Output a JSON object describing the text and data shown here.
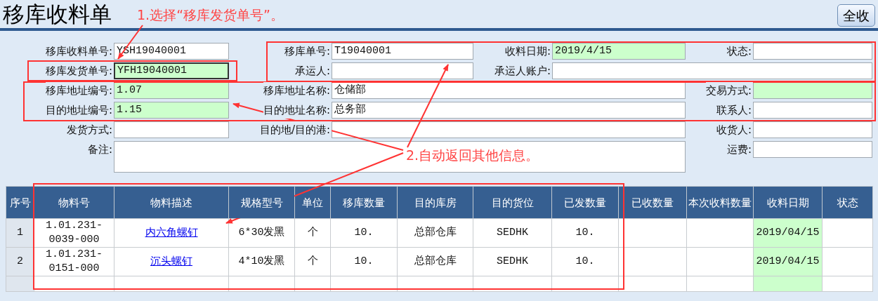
{
  "title": "移库收料单",
  "receive_all_button": "全收",
  "form": {
    "rows": [
      [
        {
          "label": "移库收料单号:",
          "value": "YSH19040001",
          "highlighted": false,
          "focused": false
        },
        {
          "label": "移库单号:",
          "value": "T19040001",
          "highlighted": false,
          "focused": false
        },
        {
          "label": "收料日期:",
          "value": "2019/4/15",
          "highlighted": true,
          "focused": false
        },
        {
          "label": "状态:",
          "highlighted": false,
          "focused": false
        }
      ],
      [
        {
          "label": "移库发货单号:",
          "value": "YFH19040001",
          "highlighted": true,
          "focused": true
        },
        {
          "label": "承运人:",
          "highlighted": false,
          "focused": false
        },
        {
          "label": "承运人账户:",
          "highlighted": false,
          "focused": false
        }
      ],
      [
        {
          "label": "移库地址编号:",
          "value": "1.07",
          "highlighted": true,
          "focused": false
        },
        {
          "label": "移库地址名称:",
          "value": "仓储部",
          "highlighted": false,
          "focused": false
        },
        {
          "label": "交易方式:",
          "highlighted": true,
          "focused": false
        }
      ],
      [
        {
          "label": "目的地址编号:",
          "value": "1.15",
          "highlighted": true,
          "focused": false
        },
        {
          "label": "目的地址名称:",
          "value": "总务部",
          "highlighted": false,
          "focused": false
        },
        {
          "label": "联系人:",
          "highlighted": false,
          "focused": false
        }
      ],
      [
        {
          "label": "发货方式:",
          "highlighted": false,
          "focused": false
        },
        {
          "label": "目的地/目的港:",
          "highlighted": false,
          "focused": false
        },
        {
          "label": "收货人:",
          "highlighted": false,
          "focused": false
        }
      ]
    ],
    "remark": {
      "label": "备注:",
      "highlighted": false,
      "focused": false
    },
    "freight": {
      "label": "运费:",
      "highlighted": false,
      "focused": false
    }
  },
  "table": {
    "columns": [
      "序号",
      "物料号",
      "物料描述",
      "规格型号",
      "单位",
      "移库数量",
      "目的库房",
      "目的货位",
      "已发数量",
      "已收数量",
      "本次收料数量",
      "收料日期",
      "状态"
    ],
    "rows": [
      {
        "no": "1",
        "material_no": "1.01.231-0039-000",
        "description": "内六角螺钉",
        "spec": "6*30发黑",
        "unit": "个",
        "transfer_qty": "10.",
        "warehouse": "总部仓库",
        "location": "SEDHK",
        "shipped_qty": "10.",
        "receive_date": "2019/04/15",
        "highlighted": true
      },
      {
        "no": "2",
        "material_no": "1.01.231-0151-000",
        "description": "沉头螺钉",
        "spec": "4*10发黑",
        "unit": "个",
        "transfer_qty": "10.",
        "warehouse": "总部仓库",
        "location": "SEDHK",
        "shipped_qty": "10.",
        "receive_date": "2019/04/15",
        "highlighted": true
      },
      {
        "highlighted": true
      }
    ]
  },
  "annotations": [
    {
      "text": "1.选择“移库发货单号”。"
    },
    {
      "text": "2.自动返回其他信息。"
    }
  ]
}
